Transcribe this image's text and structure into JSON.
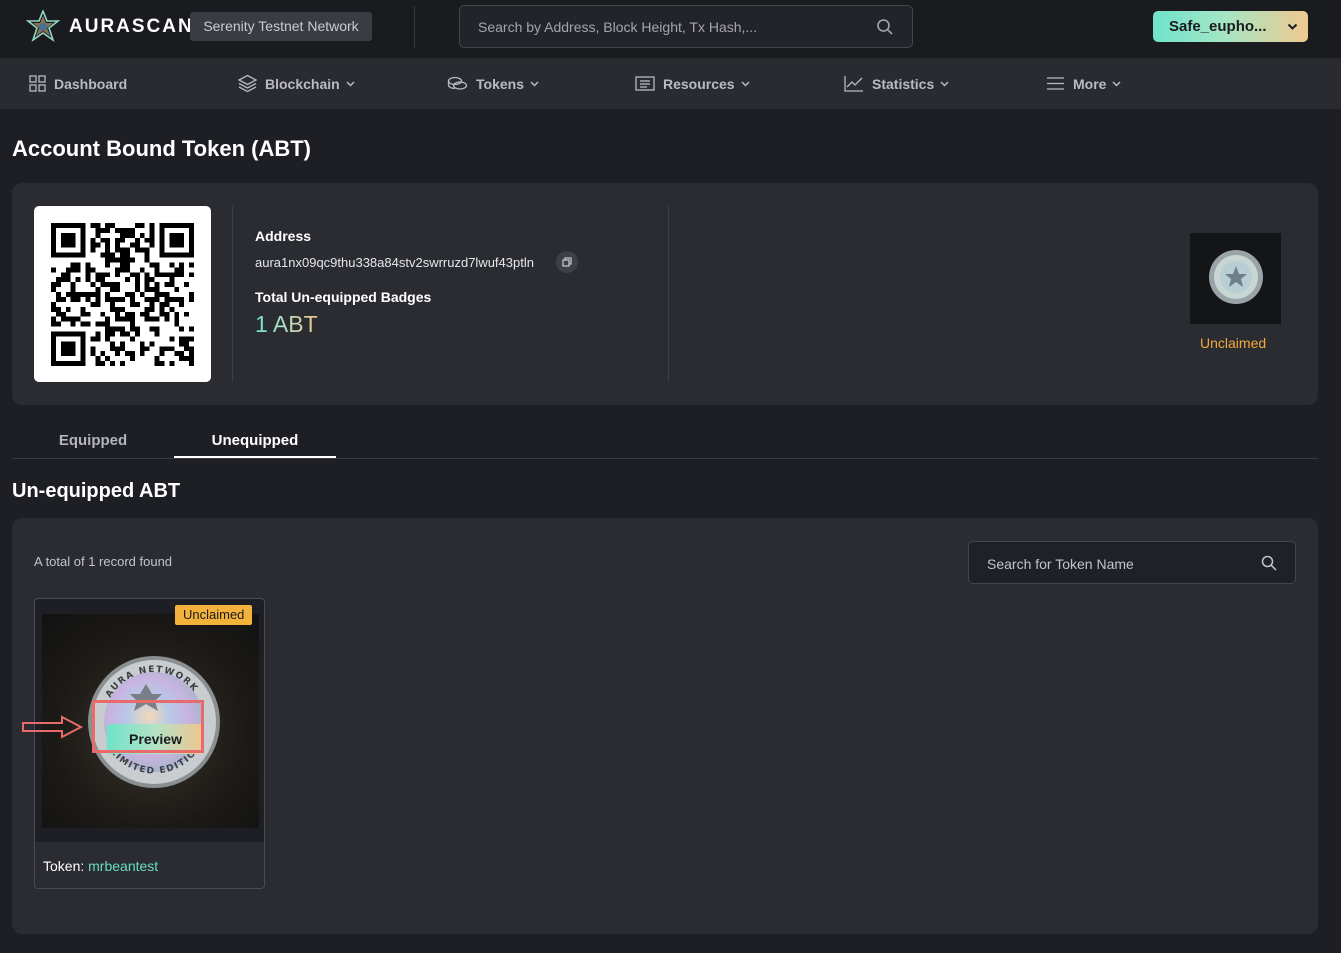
{
  "header": {
    "brand": "AURASCAN",
    "network": "Serenity Testnet Network",
    "search_placeholder": "Search by Address, Block Height, Tx Hash,...",
    "wallet_label": "Safe_eupho...",
    "logo_icon": "aura-star-logo",
    "search_icon": "search-icon"
  },
  "nav": [
    {
      "label": "Dashboard",
      "icon": "grid-icon",
      "dropdown": false
    },
    {
      "label": "Blockchain",
      "icon": "layers-icon",
      "dropdown": true
    },
    {
      "label": "Tokens",
      "icon": "coins-icon",
      "dropdown": true
    },
    {
      "label": "Resources",
      "icon": "list-box-icon",
      "dropdown": true
    },
    {
      "label": "Statistics",
      "icon": "line-chart-icon",
      "dropdown": true
    },
    {
      "label": "More",
      "icon": "menu-icon",
      "dropdown": true
    }
  ],
  "page": {
    "title": "Account Bound Token (ABT)"
  },
  "account": {
    "address_label": "Address",
    "address": "aura1nx09qc9thu338a84stv2swrruzd7lwuf43ptln",
    "total_label": "Total Un-equipped Badges",
    "total_value": "1 ABT",
    "thumb_status": "Unclaimed"
  },
  "tabs": [
    {
      "label": "Equipped",
      "active": false
    },
    {
      "label": "Unequipped",
      "active": true
    }
  ],
  "list": {
    "section_title": "Un-equipped ABT",
    "record_count": "A total of 1 record found",
    "search_placeholder": "Search for Token Name",
    "items": [
      {
        "status": "Unclaimed",
        "preview_label": "Preview",
        "token_label": "Token:",
        "token_name": "mrbeantest",
        "coin_top_text": "AURA NETWORK",
        "coin_bottom_text": "LIMITED EDITION"
      }
    ]
  },
  "colors": {
    "background": "#1e1f24",
    "card": "#2b2c32",
    "accent_teal": "#6fe3c9",
    "accent_orange": "#f0a93b",
    "badge_bg": "#f3b23a",
    "annotation_red": "#e86b6b"
  }
}
